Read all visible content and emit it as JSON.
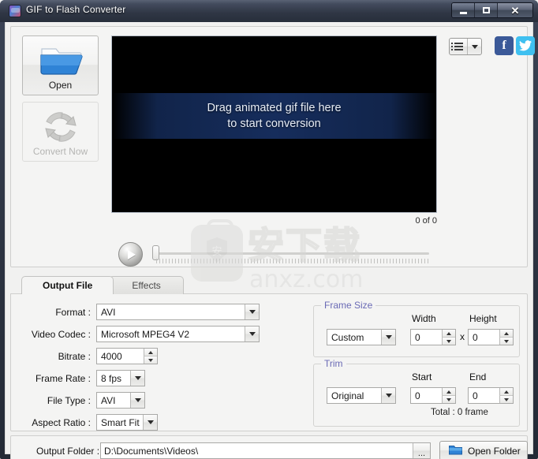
{
  "window": {
    "title": "GIF to Flash Converter",
    "icon": "app-icon",
    "controls": {
      "minimize": "minimize",
      "maximize": "maximize",
      "close": "close"
    }
  },
  "toolbar": {
    "open_button": {
      "label": "Open",
      "icon": "open-folder-icon",
      "enabled": true
    },
    "convert_button": {
      "label": "Convert Now",
      "icon": "convert-refresh-icon",
      "enabled": false
    },
    "list_button": {
      "icon": "list-view-icon",
      "dropdown_icon": "chevron-down-icon"
    },
    "facebook_button": {
      "icon": "facebook-icon",
      "label": "f"
    },
    "twitter_button": {
      "icon": "twitter-icon"
    }
  },
  "preview": {
    "drop_line1": "Drag animated gif file here",
    "drop_line2": "to start conversion",
    "counter": "0 of 0",
    "play_button_icon": "play-icon",
    "slider_name": "frame-slider"
  },
  "watermark": {
    "cn_text": "安下载",
    "url": "anxz.com",
    "shield_char": "安"
  },
  "tabs": [
    {
      "id": "output-file",
      "label": "Output File",
      "active": true
    },
    {
      "id": "effects",
      "label": "Effects",
      "active": false
    }
  ],
  "output_form": {
    "fields": [
      {
        "id": "format",
        "label": "Format :",
        "value": "AVI",
        "control": "dropdown"
      },
      {
        "id": "video-codec",
        "label": "Video Codec :",
        "value": "Microsoft MPEG4 V2",
        "control": "dropdown"
      },
      {
        "id": "bitrate",
        "label": "Bitrate :",
        "value": "4000",
        "control": "spinner"
      },
      {
        "id": "frame-rate",
        "label": "Frame Rate :",
        "value": "8 fps",
        "control": "dropdown"
      },
      {
        "id": "file-type",
        "label": "File Type :",
        "value": "AVI",
        "control": "dropdown"
      },
      {
        "id": "aspect-ratio",
        "label": "Aspect Ratio :",
        "value": "Smart Fit",
        "control": "dropdown"
      }
    ]
  },
  "frame_size": {
    "title": "Frame Size",
    "preset": "Custom",
    "width_label": "Width",
    "height_label": "Height",
    "width_value": "0",
    "height_value": "0",
    "separator": "x"
  },
  "trim": {
    "title": "Trim",
    "preset": "Original",
    "start_label": "Start",
    "end_label": "End",
    "start_value": "0",
    "end_value": "0",
    "total": "Total : 0 frame"
  },
  "output_folder": {
    "label": "Output Folder :",
    "path": "D:\\Documents\\Videos\\",
    "browse_label": "...",
    "open_button_label": "Open Folder",
    "open_button_icon": "folder-icon"
  },
  "colors": {
    "group_title": "#6a6ab5",
    "facebook": "#3b5998",
    "twitter": "#3fc0f0",
    "folder_blue": "#2a7fd4",
    "video_bg": "#000000"
  }
}
